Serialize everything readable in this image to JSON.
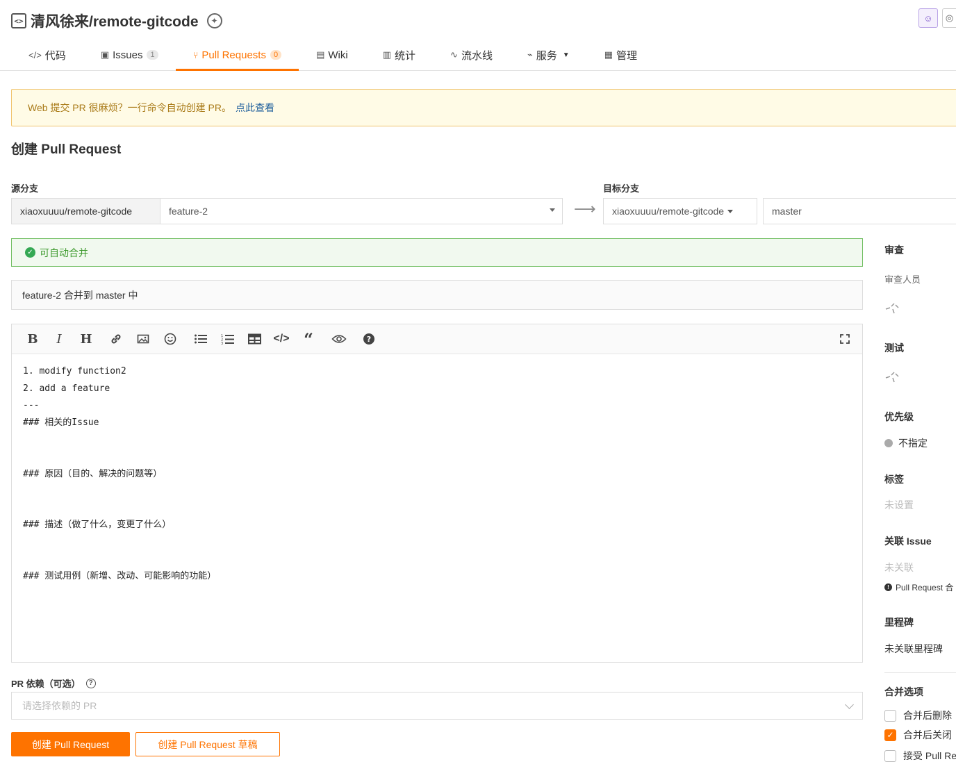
{
  "repo": {
    "title": "清风徐来/remote-gitcode"
  },
  "tabs": [
    {
      "label": "代码",
      "icon": "code-icon"
    },
    {
      "label": "Issues",
      "count": "1",
      "icon": "issues-icon"
    },
    {
      "label": "Pull Requests",
      "count": "0",
      "icon": "pull-request-icon",
      "active": true
    },
    {
      "label": "Wiki",
      "icon": "book-icon"
    },
    {
      "label": "统计",
      "icon": "bar-chart-icon"
    },
    {
      "label": "流水线",
      "icon": "pipeline-icon"
    },
    {
      "label": "服务",
      "icon": "pulse-icon"
    },
    {
      "label": "管理",
      "icon": "manage-icon"
    }
  ],
  "banner": {
    "text": "Web 提交 PR 很麻烦？一行命令自动创建 PR。",
    "link": "点此查看"
  },
  "page": {
    "title": "创建 Pull Request"
  },
  "source": {
    "label": "源分支",
    "repo": "xiaoxuuuu/remote-gitcode",
    "branch": "feature-2"
  },
  "target": {
    "label": "目标分支",
    "repo": "xiaoxuuuu/remote-gitcode",
    "branch": "master"
  },
  "merge_status": "可自动合并",
  "pr_title": "feature-2 合并到 master 中",
  "editor": {
    "lines": [
      "1. modify function2",
      "2. add a feature",
      "---",
      "### 相关的Issue",
      "",
      "",
      "### 原因（目的、解决的问题等）",
      "",
      "",
      "### 描述（做了什么，变更了什么）",
      "",
      "",
      "### 测试用例（新增、改动、可能影响的功能）"
    ]
  },
  "dependency": {
    "label": "PR 依赖（可选）",
    "placeholder": "请选择依赖的 PR"
  },
  "buttons": {
    "create": "创建 Pull Request",
    "draft": "创建 Pull Request 草稿"
  },
  "sidebar": {
    "review_head": "审查",
    "reviewers_label": "审查人员",
    "test_head": "测试",
    "priority_head": "优先级",
    "priority_value": "不指定",
    "labels_head": "标签",
    "labels_value": "未设置",
    "issue_head": "关联 Issue",
    "issue_value": "未关联",
    "issue_note": "Pull Request 合",
    "milestone_head": "里程碑",
    "milestone_value": "未关联里程碑",
    "merge_head": "合并选项",
    "options": [
      {
        "label": "合并后删除",
        "checked": false
      },
      {
        "label": "合并后关闭",
        "checked": true
      },
      {
        "label": "接受 Pull Re",
        "checked": false
      }
    ]
  },
  "colors": {
    "accent": "#fe7300",
    "success": "#3d9a2d",
    "warning_bg": "#fffbe6"
  }
}
